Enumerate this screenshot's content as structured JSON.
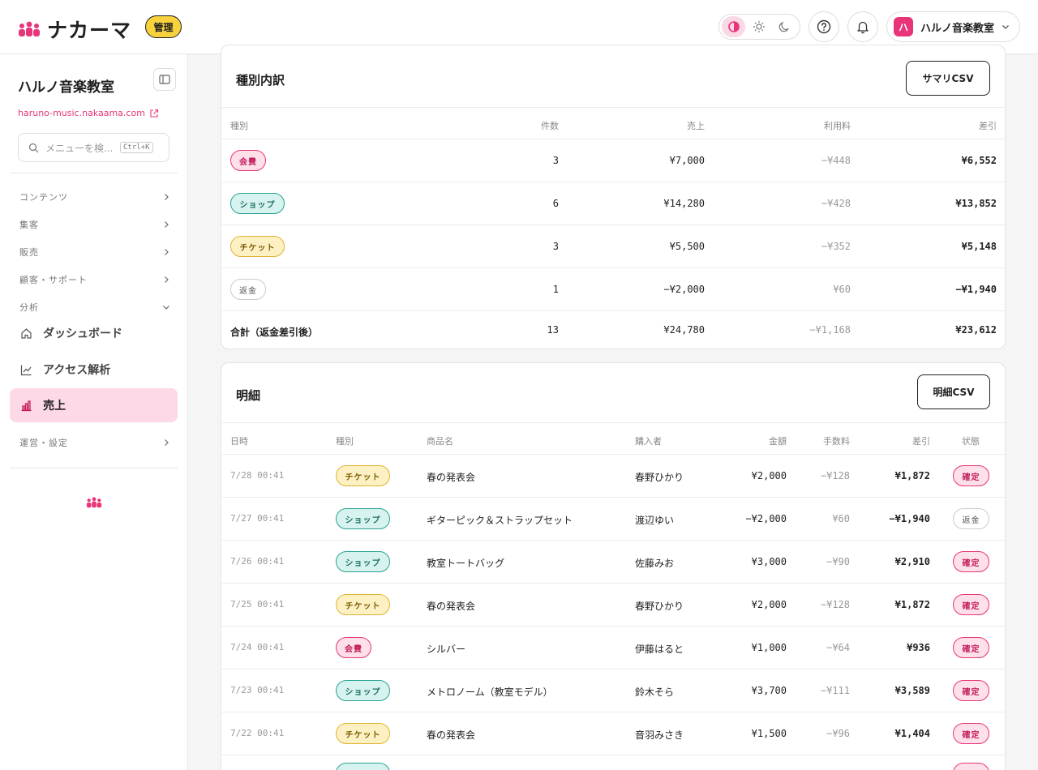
{
  "brand": {
    "name": "ナカーマ",
    "badge": "管理"
  },
  "header": {
    "org_name": "ハルノ音楽教室",
    "org_initial": "ハ"
  },
  "sidebar": {
    "title": "ハルノ音楽教室",
    "site_link": "haruno-music.nakaama.com",
    "search_placeholder": "メニューを検...",
    "search_shortcut": "Ctrl+K",
    "sections": [
      "コンテンツ",
      "集客",
      "販売",
      "顧客・サポート",
      "分析",
      "運営・設定"
    ],
    "items": [
      {
        "label": "ダッシュボード"
      },
      {
        "label": "アクセス解析"
      },
      {
        "label": "売上"
      }
    ]
  },
  "summary": {
    "title": "種別内訳",
    "csv_label": "サマリCSV",
    "columns": [
      "種別",
      "件数",
      "売上",
      "利用料",
      "差引"
    ],
    "rows": [
      {
        "type": "会費",
        "count": "3",
        "sales": "¥7,000",
        "fee": "−¥448",
        "net": "¥6,552"
      },
      {
        "type": "ショップ",
        "count": "6",
        "sales": "¥14,280",
        "fee": "−¥428",
        "net": "¥13,852"
      },
      {
        "type": "チケット",
        "count": "3",
        "sales": "¥5,500",
        "fee": "−¥352",
        "net": "¥5,148"
      },
      {
        "type": "返金",
        "count": "1",
        "sales": "−¥2,000",
        "fee": "¥60",
        "net": "−¥1,940"
      }
    ],
    "total": {
      "label": "合計（返金差引後）",
      "count": "13",
      "sales": "¥24,780",
      "fee": "−¥1,168",
      "net": "¥23,612"
    }
  },
  "detail": {
    "title": "明細",
    "csv_label": "明細CSV",
    "columns": [
      "日時",
      "種別",
      "商品名",
      "購入者",
      "金額",
      "手数料",
      "差引",
      "状態"
    ],
    "rows": [
      {
        "date": "7/28 00:41",
        "type": "チケット",
        "item": "春の発表会",
        "buyer": "春野ひかり",
        "amount": "¥2,000",
        "fee": "−¥128",
        "net": "¥1,872",
        "status": "確定"
      },
      {
        "date": "7/27 00:41",
        "type": "ショップ",
        "item": "ギターピック＆ストラップセット",
        "buyer": "渡辺ゆい",
        "amount": "−¥2,000",
        "fee": "¥60",
        "net": "−¥1,940",
        "status": "返金"
      },
      {
        "date": "7/26 00:41",
        "type": "ショップ",
        "item": "教室トートバッグ",
        "buyer": "佐藤みお",
        "amount": "¥3,000",
        "fee": "−¥90",
        "net": "¥2,910",
        "status": "確定"
      },
      {
        "date": "7/25 00:41",
        "type": "チケット",
        "item": "春の発表会",
        "buyer": "春野ひかり",
        "amount": "¥2,000",
        "fee": "−¥128",
        "net": "¥1,872",
        "status": "確定"
      },
      {
        "date": "7/24 00:41",
        "type": "会費",
        "item": "シルバー",
        "buyer": "伊藤はると",
        "amount": "¥1,000",
        "fee": "−¥64",
        "net": "¥936",
        "status": "確定"
      },
      {
        "date": "7/23 00:41",
        "type": "ショップ",
        "item": "メトロノーム（教室モデル）",
        "buyer": "鈴木そら",
        "amount": "¥3,700",
        "fee": "−¥111",
        "net": "¥3,589",
        "status": "確定"
      },
      {
        "date": "7/22 00:41",
        "type": "チケット",
        "item": "春の発表会",
        "buyer": "音羽みさき",
        "amount": "¥1,500",
        "fee": "−¥96",
        "net": "¥1,404",
        "status": "確定"
      }
    ]
  },
  "colors": {
    "accent": "#e8357a",
    "accent_soft": "#fdd8e7",
    "badge_yellow": "#f8d23c"
  }
}
